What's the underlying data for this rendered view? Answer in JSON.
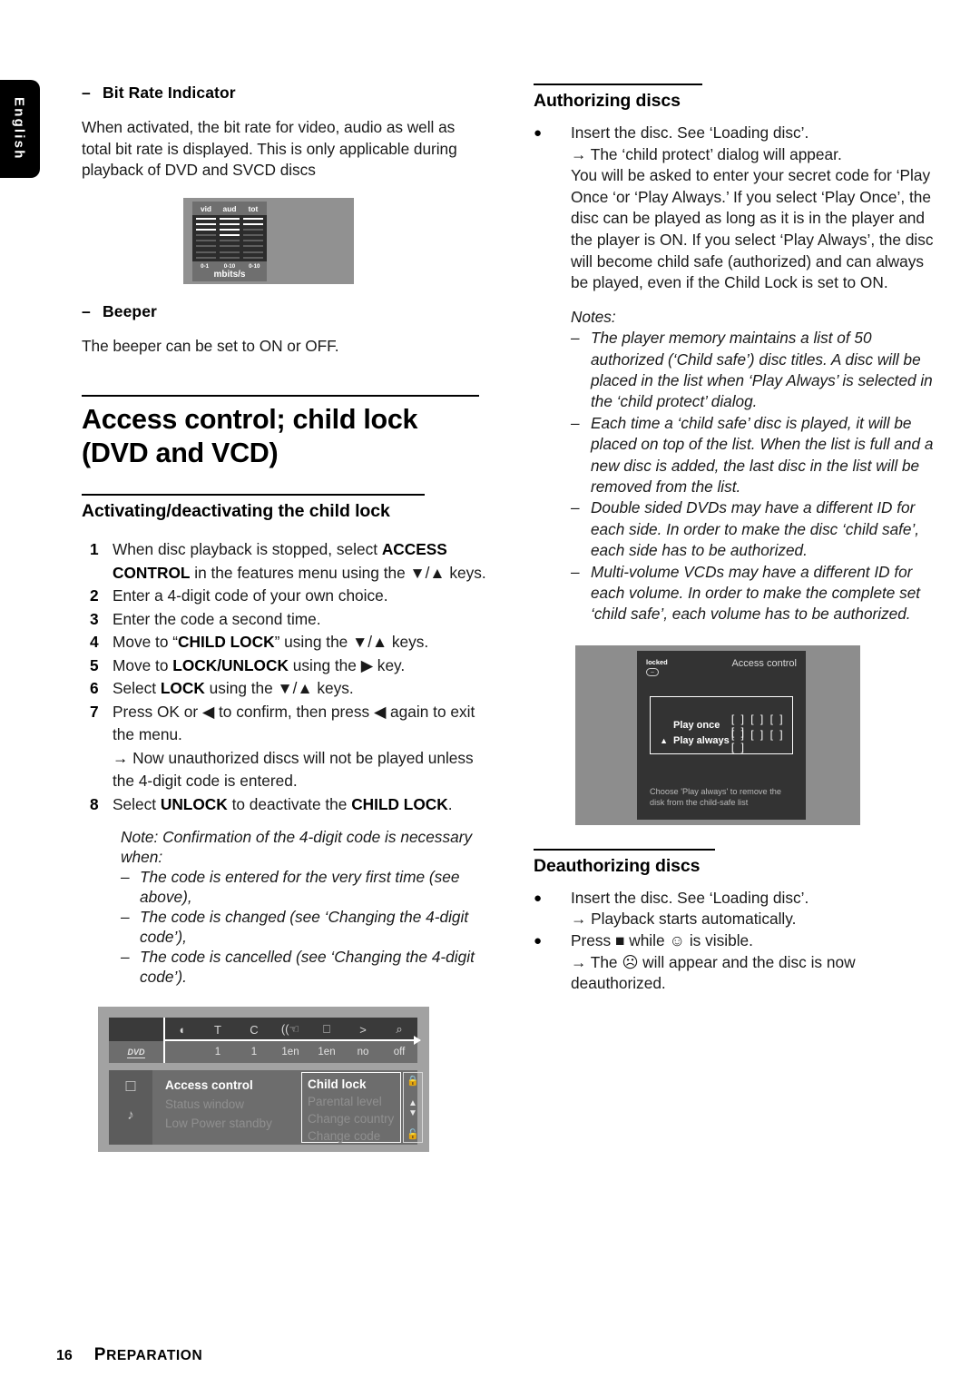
{
  "language_tab": "English",
  "left_column": {
    "bit_rate": {
      "dash": "–",
      "heading": "Bit Rate Indicator",
      "paragraph": "When activated, the bit rate for video, audio as well as total bit rate is displayed. This is only applicable during playback of DVD and SVCD discs"
    },
    "bit_rate_figure": {
      "columns": [
        "vid",
        "aud",
        "tot"
      ],
      "scales": [
        "0-1",
        "0-10",
        "0-10"
      ],
      "unit": "mbits/s"
    },
    "beeper": {
      "dash": "–",
      "heading": "Beeper",
      "paragraph": "The beeper can be set to ON or OFF."
    },
    "section_title_line1": "Access control; child lock",
    "section_title_line2": "(DVD and VCD)",
    "section_sub": "Activating/deactivating the child lock",
    "steps": [
      {
        "num": "1",
        "html": "When disc playback is stopped, select <b>ACCESS CONTROL</b> in the features menu using the ▼/▲ keys."
      },
      {
        "num": "2",
        "html": "Enter a 4-digit code of your own choice."
      },
      {
        "num": "3",
        "html": "Enter the code a second time."
      },
      {
        "num": "4",
        "html": "Move to “<b>CHILD LOCK</b>” using the ▼/▲ keys."
      },
      {
        "num": "5",
        "html": "Move to <b>LOCK/UNLOCK</b> using the ▶ key."
      },
      {
        "num": "6",
        "html": "Select <b>LOCK</b> using the ▼/▲ keys."
      },
      {
        "num": "7",
        "html": "Press OK or ◀ to confirm, then press ◀ again to exit the menu.<br><b>→</b> Now unauthorized discs will not be played unless the 4-digit code is entered."
      },
      {
        "num": "8",
        "html": "Select <b>UNLOCK</b> to deactivate the <b>CHILD LOCK</b>."
      }
    ],
    "note_intro": "Note: Confirmation of the 4-digit code is necessary when:",
    "note_items": [
      "The code is entered for the very first time (see above),",
      "The code is changed (see ‘Changing the 4-digit code’),",
      "The code is cancelled (see ‘Changing the 4-digit code’)."
    ],
    "menu_figure": {
      "toolbar_icons": [
        "disc-icon",
        "title-icon",
        "chapter-icon",
        "audio-icon",
        "subtitle-icon",
        "angle-icon",
        "zoom-icon"
      ],
      "toolbar_values": [
        "DVD",
        "1",
        "1",
        "1en",
        "1en",
        "no",
        "off"
      ],
      "rail_icons": [
        "picture-icon",
        "sound-icon"
      ],
      "list_items": [
        "Access control",
        "Status window",
        "Low Power standby"
      ],
      "list_active": "Access control",
      "sub_items": [
        "Child lock",
        "Parental level",
        "Change country",
        "Change code"
      ],
      "sub_active": "Child lock",
      "scroll_icons": [
        "locked-icon",
        "updown-icon",
        "unlocked-icon"
      ]
    }
  },
  "right_column": {
    "authorizing": {
      "heading": "Authorizing discs",
      "bullet_line1": "Insert the disc. See ‘Loading disc’.",
      "bullet_arrow": "→ The ‘child protect’ dialog will appear.",
      "bullet_body": "You will be asked to enter your secret code for ‘Play Once ‘or ‘Play Always.’ If you select ‘Play Once’, the disc can be played as long as it is in the player and the player is ON. If you select ‘Play Always’, the disc will become child safe (authorized) and can always be played, even if the Child Lock is set to ON."
    },
    "notes_label": "Notes:",
    "notes": [
      "The player memory maintains a list of 50 authorized (‘Child safe’) disc titles. A disc will be placed in the list when ‘Play Always’ is selected in the ‘child protect’ dialog.",
      "Each time a ‘child safe’ disc is played, it will be placed on top of the list. When the list is full and a new disc is added, the last disc in the list will be removed from the list.",
      "Double sided DVDs may have a different ID for each side. In order to make the disc ‘child safe’, each side has to be authorized.",
      "Multi-volume VCDs may have a different ID for each volume. In order to make the complete set ‘child safe’, each volume has to be authorized."
    ],
    "access_figure": {
      "locked_label": "locked",
      "title": "Access control",
      "row1_label": "Play once",
      "row2_label": "Play always",
      "row2_caret": "▲",
      "code_boxes": "[ ] [ ] [ ] [ ]",
      "hint": "Choose 'Play always' to remove the disk from the child-safe list"
    },
    "deauthorizing": {
      "heading": "Deauthorizing discs",
      "b1_line1": "Insert the disc. See ‘Loading disc’.",
      "b1_line2": "→ Playback starts automatically.",
      "b2_line1": "Press ■ while ☺ is visible.",
      "b2_line2": "→ The ☹ will appear and the disc is now deauthorized."
    }
  },
  "footer": {
    "page_number": "16",
    "label_first": "P",
    "label_rest": "REPARATION"
  }
}
